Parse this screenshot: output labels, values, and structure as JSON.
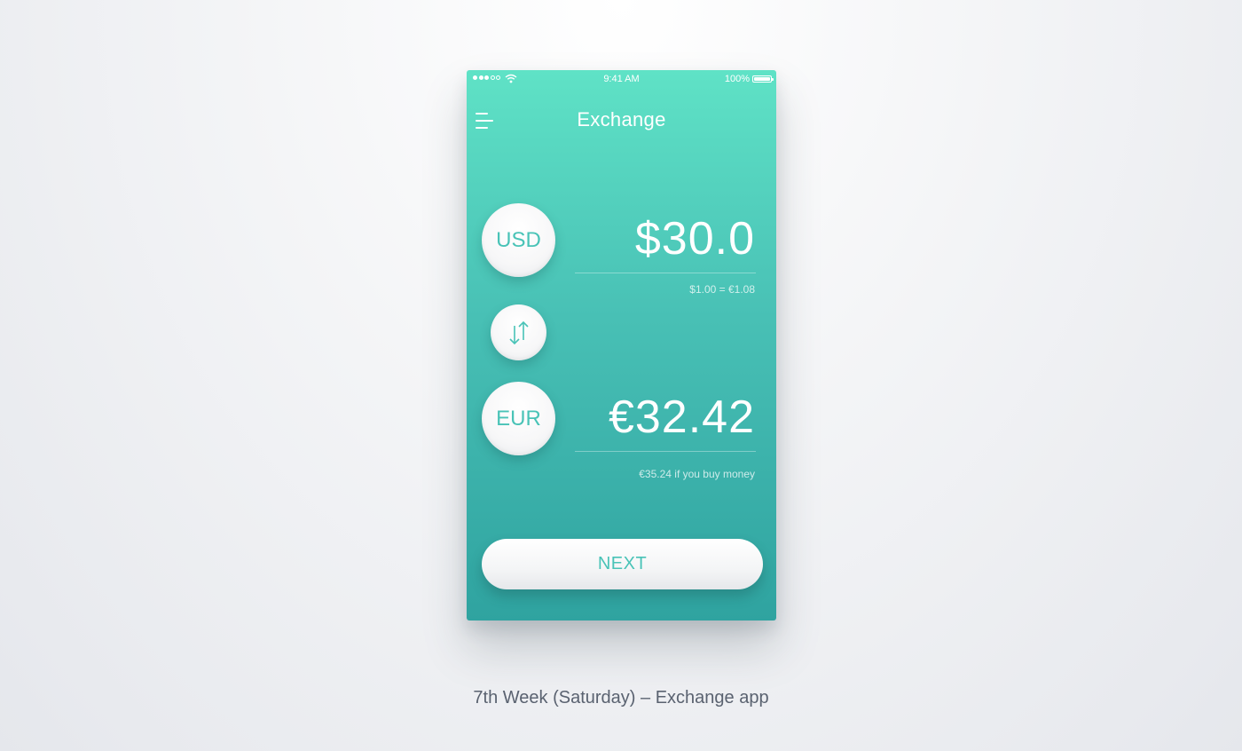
{
  "status_bar": {
    "signal_icon": "signal-dots-icon",
    "wifi_icon": "wifi-icon",
    "time": "9:41 AM",
    "battery_percent": "100%",
    "battery_icon": "battery-icon"
  },
  "header": {
    "menu_icon": "hamburger-menu-icon",
    "title": "Exchange"
  },
  "from_currency": {
    "code": "USD",
    "amount": "$30.0",
    "rate": "$1.00 = €1.08"
  },
  "swap": {
    "icon": "swap-arrows-icon"
  },
  "to_currency": {
    "code": "EUR",
    "amount": "€32.42",
    "note": "€35.24 if you buy money"
  },
  "actions": {
    "next_label": "NEXT"
  },
  "caption": "7th Week (Saturday) – Exchange app",
  "colors": {
    "gradient_top": "#5fe2c6",
    "gradient_bottom": "#2fa3a0",
    "accent": "#49c3b7",
    "background": "#eef0f3"
  }
}
